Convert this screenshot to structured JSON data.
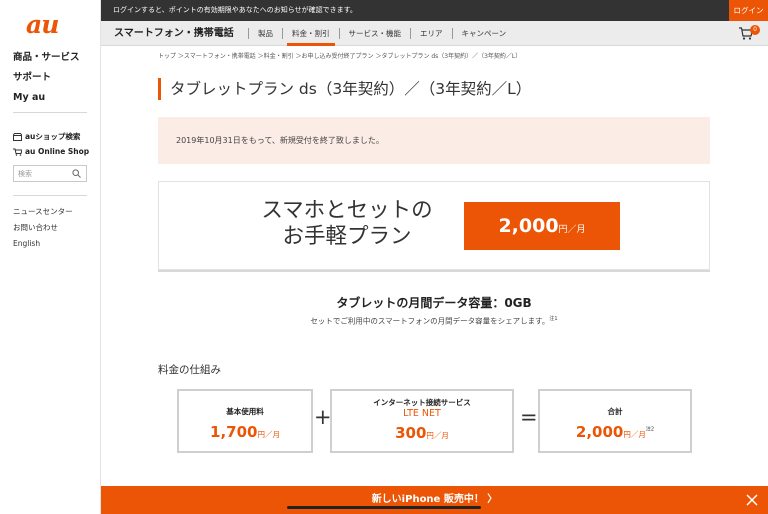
{
  "sidebar": {
    "logo": "au",
    "main_items": [
      "商品・サービス",
      "サポート",
      "My au"
    ],
    "shop_search_label": "auショップ検索",
    "online_shop_label": "au Online Shop",
    "search_placeholder": "検索",
    "sub_items": [
      "ニュースセンター",
      "お問い合わせ",
      "English"
    ]
  },
  "topbar": {
    "notice": "ログインすると、ポイントの有効期限やあなたへのお知らせが確認できます。",
    "login_label": "ログイン"
  },
  "navbar": {
    "brand": "スマートフォン・携帯電話",
    "items": [
      "製品",
      "料金・割引",
      "サービス・機能",
      "エリア",
      "キャンペーン"
    ],
    "active_index": 1,
    "cart_count": "0"
  },
  "breadcrumb": "トップ ＞スマートフォン・携帯電話 ＞料金・割引 ＞お申し込み受付終了プラン ＞タブレットプラン ds（3年契約）／（3年契約／L）",
  "page_title": "タブレットプラン ds（3年契約）／（3年契約／L）",
  "notice_text": "2019年10月31日をもって、新規受付を終了致しました。",
  "promo": {
    "line1": "スマホとセットの",
    "line2": "お手軽プラン",
    "price": "2,000",
    "unit": "円／月"
  },
  "capacity": {
    "title": "タブレットの月間データ容量：0GB",
    "subtitle": "セットでご利用中のスマートフォンの月間データ容量をシェアします。",
    "note": "注1"
  },
  "fees": {
    "section_title": "料金の仕組み",
    "basic_label": "基本使用料",
    "basic_value": "1,700",
    "basic_unit": "円／月",
    "internet_label": "インターネット接続サービス",
    "internet_service": "LTE NET",
    "internet_value": "300",
    "internet_unit": "円／月",
    "total_label": "合計",
    "total_value": "2,000",
    "total_unit": "円／月",
    "total_note": "注2",
    "plus": "+",
    "equals": "="
  },
  "banner": {
    "text": "新しいiPhone 販売中！ 〉"
  },
  "colors": {
    "accent": "#eb5505",
    "topbar": "#333333",
    "navbar": "#ececec",
    "notice_bg": "#fcece6"
  }
}
